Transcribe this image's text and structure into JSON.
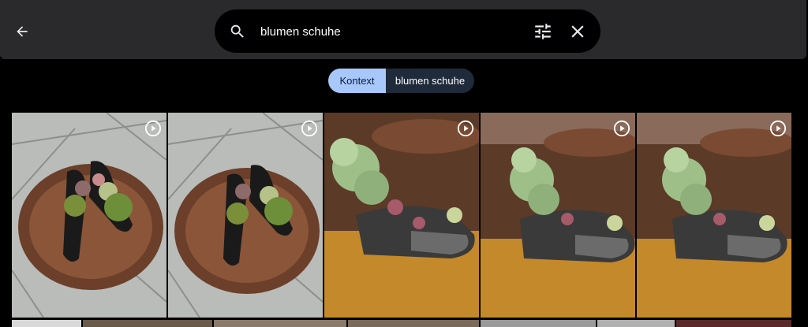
{
  "search": {
    "query": "blumen schuhe"
  },
  "chips": {
    "context_label": "Kontext",
    "query_label": "blumen schuhe"
  },
  "icons": {
    "back": "arrow-back-icon",
    "search": "search-icon",
    "filter": "tune-icon",
    "clear": "close-icon",
    "video": "play-circle-icon"
  },
  "colors": {
    "topbar": "#2a2a2c",
    "chip_active": "#a8c7fa",
    "chip_inactive": "#1f2a3a"
  },
  "results": [
    {
      "type": "video",
      "subject": "shoes-in-bowl-top"
    },
    {
      "type": "video",
      "subject": "shoes-in-bowl-top"
    },
    {
      "type": "video",
      "subject": "sneaker-succulent"
    },
    {
      "type": "video",
      "subject": "sneaker-succulent"
    },
    {
      "type": "video",
      "subject": "sneaker-succulent"
    }
  ]
}
